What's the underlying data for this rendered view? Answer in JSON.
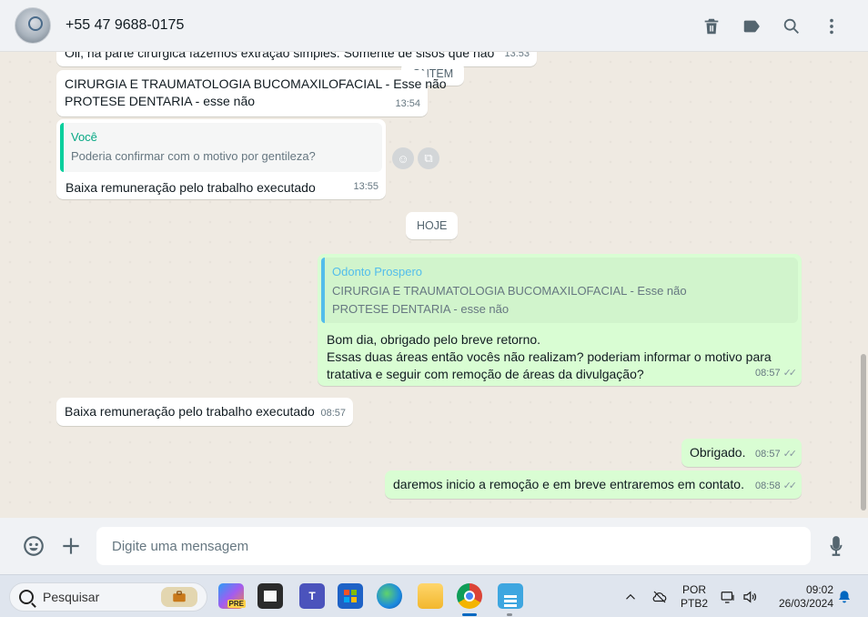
{
  "header": {
    "contact_name": "+55 47 9688-0175"
  },
  "chat": {
    "messages": [
      {
        "type": "in",
        "text": "Oii, na parte cirurgica fazemos extração simples. Somente de sisos que não",
        "time": "13:53"
      },
      {
        "type": "system",
        "text": "ONTEM"
      },
      {
        "type": "in",
        "lines": [
          "CIRURGIA E TRAUMATOLOGIA BUCOMAXILOFACIAL - Esse não",
          "PROTESE DENTARIA - esse não"
        ],
        "time": "13:54"
      },
      {
        "type": "in",
        "quote_author": "Você",
        "quote_text": "Poderia confirmar com o motivo por gentileza?",
        "text": "Baixa remuneração pelo trabalho executado",
        "time": "13:55"
      },
      {
        "type": "system",
        "text": "HOJE"
      },
      {
        "type": "out",
        "quote_author": "Odonto Prospero",
        "quote_lines": [
          "CIRURGIA E TRAUMATOLOGIA BUCOMAXILOFACIAL - Esse não",
          "PROTESE DENTARIA - esse não"
        ],
        "lines": [
          "Bom dia, obrigado pelo breve retorno.",
          "Essas duas áreas então vocês não realizam? poderiam informar o motivo para",
          "tratativa e seguir com remoção de áreas da divulgação?"
        ],
        "time": "08:57"
      },
      {
        "type": "in",
        "text": "Baixa remuneração pelo trabalho executado",
        "time": "08:57"
      },
      {
        "type": "out",
        "text": "Obrigado.",
        "time": "08:57"
      },
      {
        "type": "out",
        "text": "daremos inicio a remoção e em breve entraremos em contato.",
        "time": "08:58"
      }
    ]
  },
  "composer": {
    "placeholder": "Digite uma mensagem"
  },
  "taskbar": {
    "search_placeholder": "Pesquisar",
    "language": "POR",
    "layout": "PTB2",
    "time": "09:02",
    "date": "26/03/2024",
    "teams_letter": "T",
    "copilot_badge": "PRE"
  },
  "colors": {
    "accent_green": "#06cf9c",
    "quote_blue": "#53bdeb",
    "outgoing_bubble": "#d9fdd3",
    "incoming_bubble": "#ffffff",
    "chat_background": "#efeae2"
  }
}
